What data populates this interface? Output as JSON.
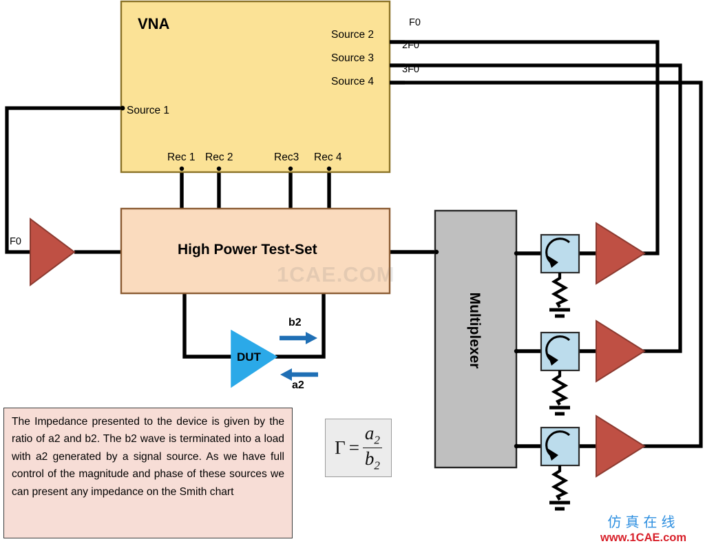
{
  "diagram": {
    "title_blocks": {
      "vna": "VNA",
      "test_set": "High Power Test-Set",
      "dut": "DUT",
      "multiplexer": "Multiplexer"
    },
    "vna_ports": {
      "source_1": "Source 1",
      "source_2": "Source 2",
      "source_3": "Source 3",
      "source_4": "Source 4",
      "receivers": [
        "Rec 1",
        "Rec 2",
        "Rec3",
        "Rec 4"
      ]
    },
    "frequency_labels": {
      "line_1": "F0",
      "line_2": "2F0",
      "line_3": "3F0",
      "input_amp": "F0"
    },
    "wave_labels": {
      "forward": "b2",
      "reverse": "a2"
    },
    "note": "The Impedance presented to the device is given by the ratio of a2 and b2. The b2 wave is terminated into a load with a2 generated by a signal source. As we have full control of the magnitude and phase of these sources we can present any impedance on the Smith chart",
    "formula": {
      "symbol": "Γ",
      "equals": "=",
      "numerator": "a",
      "numerator_sub": "2",
      "denominator": "b",
      "denominator_sub": "2"
    },
    "watermarks": {
      "center": "1CAE.COM",
      "brand_cn": "仿真在线",
      "brand_url": "www.1CAE.com"
    },
    "colors": {
      "vna_fill": "#fbe296",
      "vna_stroke": "#8a7226",
      "test_set_fill": "#fadbbe",
      "test_set_stroke": "#8a5b32",
      "mux_fill": "#bfbfbf",
      "mux_stroke": "#262626",
      "amplifier_fill": "#bf5044",
      "amplifier_stroke": "#8c3a30",
      "dut_fill": "#2ba9e8",
      "circulator_fill": "#bcdcec",
      "circulator_stroke": "#2b2b2b",
      "wire": "#000000",
      "arrow_blue": "#1f6fb5",
      "note_fill": "#f7ddd6"
    },
    "counts": {
      "sources": 4,
      "receivers": 4,
      "harmonic_branches": 3,
      "circulators": 3,
      "power_amplifiers": 4
    }
  }
}
